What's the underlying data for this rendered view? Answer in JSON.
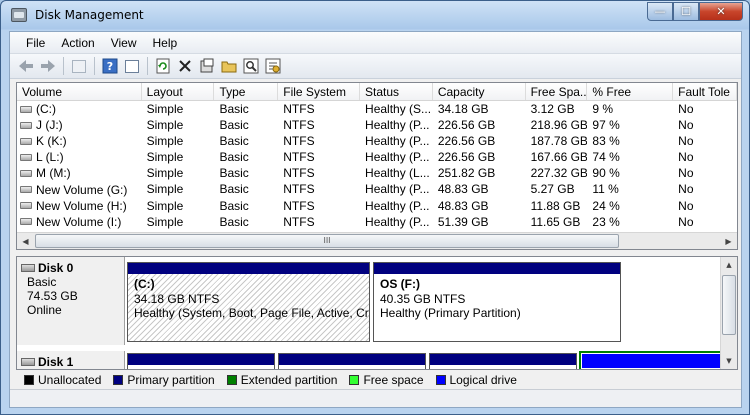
{
  "window": {
    "title": "Disk Management",
    "controls": {
      "minimize": "—",
      "maximize": "☐",
      "close": "✕"
    }
  },
  "menu": [
    "File",
    "Action",
    "View",
    "Help"
  ],
  "toolbar": {
    "buttons": [
      "back-icon",
      "forward-icon",
      "console-tree-icon",
      "help-icon",
      "properties-icon",
      "refresh-icon",
      "delete-icon",
      "settings-icon",
      "open-icon",
      "search-icon",
      "export-icon"
    ]
  },
  "volumes": {
    "columns": [
      "Volume",
      "Layout",
      "Type",
      "File System",
      "Status",
      "Capacity",
      "Free Spa...",
      "% Free",
      "Fault Tole"
    ],
    "rows": [
      [
        "(C:)",
        "Simple",
        "Basic",
        "NTFS",
        "Healthy (S...",
        "34.18 GB",
        "3.12 GB",
        "9 %",
        "No"
      ],
      [
        "J (J:)",
        "Simple",
        "Basic",
        "NTFS",
        "Healthy (P...",
        "226.56 GB",
        "218.96 GB",
        "97 %",
        "No"
      ],
      [
        "K (K:)",
        "Simple",
        "Basic",
        "NTFS",
        "Healthy (P...",
        "226.56 GB",
        "187.78 GB",
        "83 %",
        "No"
      ],
      [
        "L (L:)",
        "Simple",
        "Basic",
        "NTFS",
        "Healthy (P...",
        "226.56 GB",
        "167.66 GB",
        "74 %",
        "No"
      ],
      [
        "M (M:)",
        "Simple",
        "Basic",
        "NTFS",
        "Healthy (L...",
        "251.82 GB",
        "227.32 GB",
        "90 %",
        "No"
      ],
      [
        "New Volume (G:)",
        "Simple",
        "Basic",
        "NTFS",
        "Healthy (P...",
        "48.83 GB",
        "5.27 GB",
        "11 %",
        "No"
      ],
      [
        "New Volume (H:)",
        "Simple",
        "Basic",
        "NTFS",
        "Healthy (P...",
        "48.83 GB",
        "11.88 GB",
        "24 %",
        "No"
      ],
      [
        "New Volume (I:)",
        "Simple",
        "Basic",
        "NTFS",
        "Healthy (P...",
        "51.39 GB",
        "11.65 GB",
        "23 %",
        "No"
      ]
    ],
    "scroll_grip": "III"
  },
  "disks": [
    {
      "name": "Disk 0",
      "type": "Basic",
      "size": "74.53 GB",
      "state": "Online",
      "partitions": [
        {
          "label": "(C:)",
          "size": "34.18 GB NTFS",
          "status": "Healthy (System, Boot, Page File, Active, Crash"
        },
        {
          "label": "OS  (F:)",
          "size": "40.35 GB NTFS",
          "status": "Healthy (Primary Partition)"
        }
      ]
    },
    {
      "name": "Disk 1"
    }
  ],
  "legend": [
    {
      "label": "Unallocated",
      "color": "#000000"
    },
    {
      "label": "Primary partition",
      "color": "#00007f"
    },
    {
      "label": "Extended partition",
      "color": "#008000"
    },
    {
      "label": "Free space",
      "color": "#33ff33"
    },
    {
      "label": "Logical drive",
      "color": "#0000ff"
    }
  ]
}
